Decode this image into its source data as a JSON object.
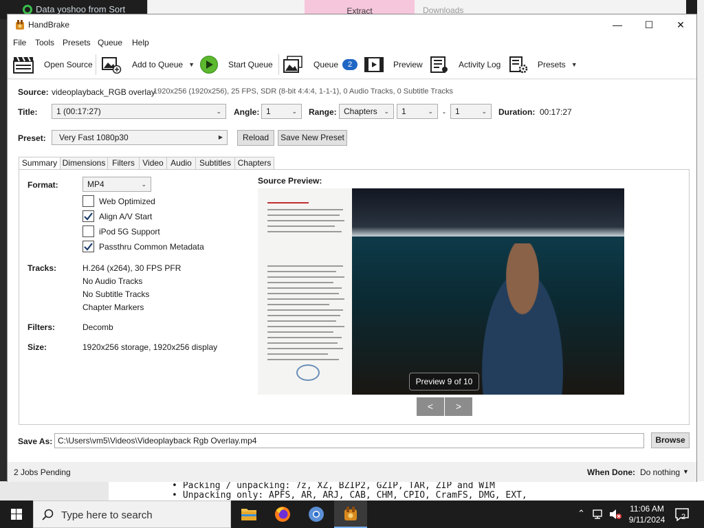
{
  "background": {
    "top_title": "Data yoshoo from Sort",
    "explorer_extract": "Extract",
    "explorer_downloads": "Downloads",
    "bullets": [
      "Packing / unpacking: 7z, XZ, BZIP2, GZIP, TAR, ZIP and WIM",
      "Unpacking only: APFS, AR, ARJ, CAB, CHM, CPIO, CramFS, DMG, EXT,"
    ]
  },
  "window": {
    "title": "HandBrake"
  },
  "menu": [
    "File",
    "Tools",
    "Presets",
    "Queue",
    "Help"
  ],
  "toolbar": {
    "open_source": "Open Source",
    "add_to_queue": "Add to Queue",
    "start_queue": "Start Queue",
    "queue": "Queue",
    "queue_count": "2",
    "preview": "Preview",
    "activity_log": "Activity Log",
    "presets": "Presets"
  },
  "source": {
    "label": "Source:",
    "name": "videoplayback_RGB overlay",
    "info": "1920x256 (1920x256), 25 FPS, SDR (8-bit 4:4:4, 1-1-1), 0 Audio Tracks, 0 Subtitle Tracks"
  },
  "title_row": {
    "title_label": "Title:",
    "title_value": "1  (00:17:27)",
    "angle_label": "Angle:",
    "angle_value": "1",
    "range_label": "Range:",
    "range_mode": "Chapters",
    "range_start": "1",
    "range_sep": "-",
    "range_end": "1",
    "duration_label": "Duration:",
    "duration_value": "00:17:27"
  },
  "preset": {
    "label": "Preset:",
    "value": "Very Fast 1080p30",
    "reload": "Reload",
    "save_new": "Save New Preset"
  },
  "tabs": [
    "Summary",
    "Dimensions",
    "Filters",
    "Video",
    "Audio",
    "Subtitles",
    "Chapters"
  ],
  "summary": {
    "format_label": "Format:",
    "format_value": "MP4",
    "options": [
      {
        "label": "Web Optimized",
        "checked": false
      },
      {
        "label": "Align A/V Start",
        "checked": true
      },
      {
        "label": "iPod 5G Support",
        "checked": false
      },
      {
        "label": "Passthru Common Metadata",
        "checked": true
      }
    ],
    "tracks_label": "Tracks:",
    "tracks": [
      "H.264 (x264), 30 FPS PFR",
      "No Audio Tracks",
      "No Subtitle Tracks",
      "Chapter Markers"
    ],
    "filters_label": "Filters:",
    "filters_value": "Decomb",
    "size_label": "Size:",
    "size_value": "1920x256 storage, 1920x256 display",
    "preview_label": "Source Preview:",
    "preview_overlay": "Preview 9 of 10",
    "prev": "<",
    "next": ">"
  },
  "save": {
    "label": "Save As:",
    "path": "C:\\Users\\vm5\\Videos\\Videoplayback Rgb Overlay.mp4",
    "browse": "Browse"
  },
  "status": {
    "jobs": "2 Jobs Pending",
    "when_done_label": "When Done:",
    "when_done_value": "Do nothing"
  },
  "taskbar": {
    "search_placeholder": "Type here to search",
    "time": "11:06 AM",
    "date": "9/11/2024",
    "notifications": "2"
  },
  "colors": {
    "accent": "#1f66c4",
    "play_green": "#5cb82e"
  }
}
